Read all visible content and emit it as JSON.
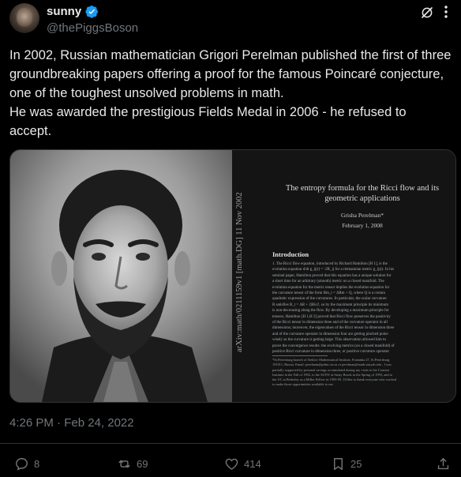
{
  "author": {
    "display_name": "sunny",
    "handle": "@thePiggsBoson"
  },
  "tweet": {
    "text": "In 2002, Russian mathematician Grigori Perelman published the first of three groundbreaking papers offering a proof for the famous Poincaré conjecture, one of the toughest unsolved problems in math.\nHe was awarded the prestigious Fields Medal in 2006 - he refused to accept.",
    "timestamp": "4:26 PM · Feb 24, 2022"
  },
  "paper": {
    "arxiv_id": "arXiv:math/0211159v1  [math.DG]  11 Nov 2002",
    "title": "The entropy formula for the Ricci flow and its geometric applications",
    "author": "Grisha Perelman*",
    "date": "February 1, 2008",
    "section_heading": "Introduction",
    "body_lines": [
      "1. The Ricci flow equation, introduced by Richard Hamilton [H 1], is the",
      "evolution equation d/dt g_ij(t) = -2R_ij for a riemannian metric g_ij(t). In his",
      "seminal paper, Hamilton proved that this equation has a unique solution for",
      "a short time for an arbitrary (smooth) metric on a closed manifold. The",
      "evolution equation for the metric tensor implies the evolution equation for",
      "the curvature tensor of the form Rm_t = ΔRm + Q, where Q is a certain",
      "quadratic expression of the curvatures. In particular, the scalar curvature",
      "R satisfies R_t = ΔR + 2|Ric|², so by the maximum principle its minimum",
      "is non-decreasing along the flow. By developing a maximum principle for",
      "tensors, Hamilton [H 1,H 2] proved that Ricci flow preserves the positivity",
      "of the Ricci tensor in dimension three and of the curvature operator in all",
      "dimensions; moreover, the eigenvalues of the Ricci tensor in dimension three",
      "and of the curvature operator in dimension four are getting pinched point-",
      "wisely as the curvature is getting large. This observation allowed him to",
      "prove the convergence results: the evolving metrics (on a closed manifold) of",
      "positive Ricci curvature in dimension three, or positive curvature operator"
    ],
    "footnote_lines": [
      "*St.Petersburg branch of Steklov Mathematical Institute, Fontanka 27, St.Petersburg",
      "191011, Russia. Email: perelman@pdmi.ras.ru or perelman@math.sunysb.edu ; I was",
      "partially supported by personal savings accumulated during my visits to the Courant",
      "Institute in the Fall of 1992, to the SUNY at Stony Brook in the Spring of 1993, and to",
      "the UC at Berkeley as a Miller Fellow in 1993-95. I'd like to thank everyone who worked",
      "to make those opportunities available to me."
    ]
  },
  "actions": {
    "reply_count": "8",
    "retweet_count": "69",
    "like_count": "414",
    "bookmark_count": "25"
  },
  "colors": {
    "background": "#000000",
    "text": "#e7e9ea",
    "secondary": "#71767b",
    "verified": "#1d9bf0"
  }
}
